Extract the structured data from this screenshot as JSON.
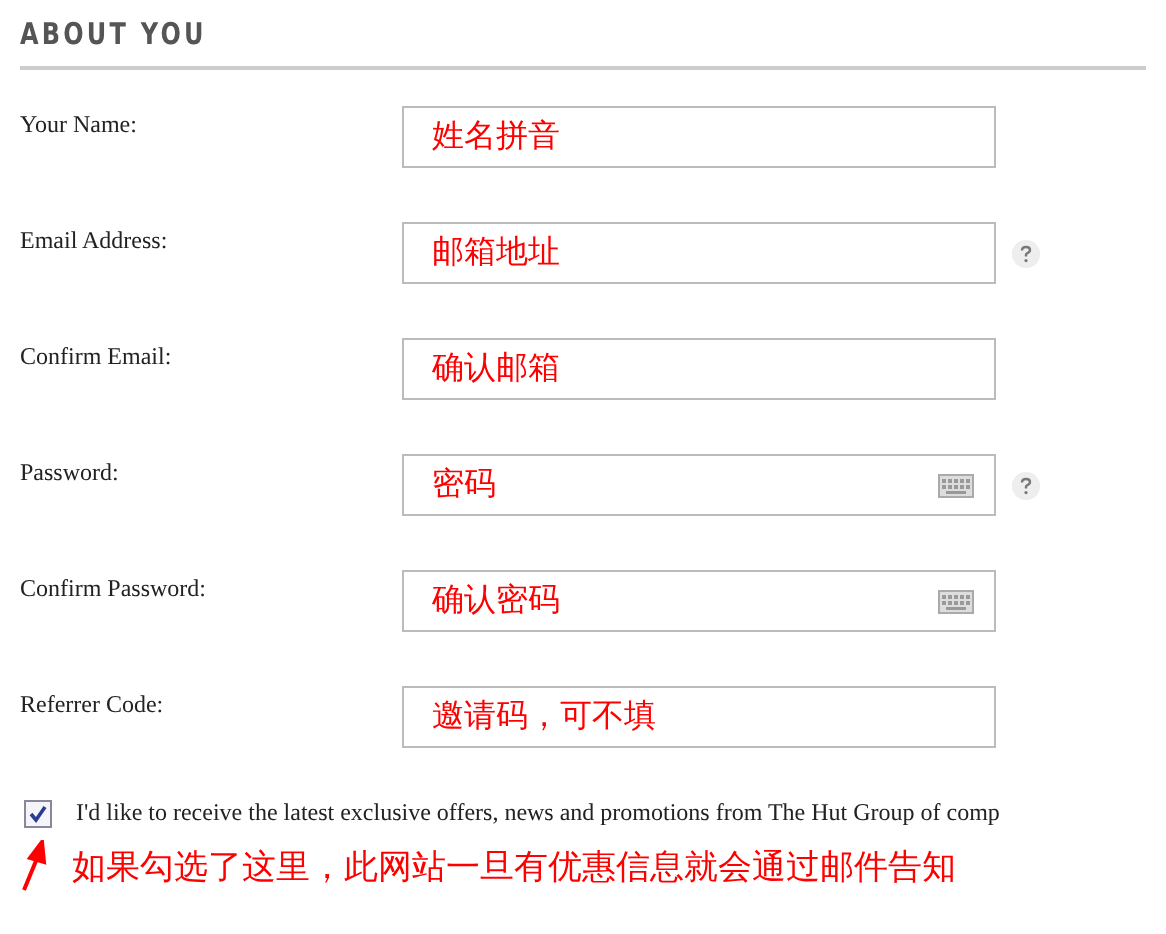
{
  "section": {
    "title": "ABOUT YOU"
  },
  "fields": [
    {
      "label": "Your Name:",
      "value": "姓名拼音",
      "keyboard": false,
      "help": false
    },
    {
      "label": "Email Address:",
      "value": "邮箱地址",
      "keyboard": false,
      "help": true
    },
    {
      "label": "Confirm Email:",
      "value": "确认邮箱",
      "keyboard": false,
      "help": false
    },
    {
      "label": "Password:",
      "value": "密码",
      "keyboard": true,
      "help": true
    },
    {
      "label": "Confirm Password:",
      "value": "确认密码",
      "keyboard": true,
      "help": false
    },
    {
      "label": "Referrer Code:",
      "value": "邀请码，可不填",
      "keyboard": false,
      "help": false
    }
  ],
  "newsletter": {
    "checked": true,
    "label": "I'd like to receive the latest exclusive offers, news and promotions from The Hut Group of comp"
  },
  "annotation": {
    "text": "如果勾选了这里，此网站一旦有优惠信息就会通过邮件告知"
  }
}
